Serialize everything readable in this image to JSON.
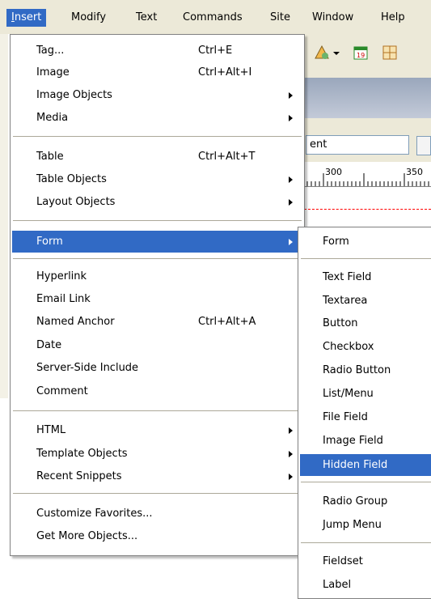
{
  "menubar": {
    "items": [
      {
        "label": "Insert",
        "accel": "I"
      },
      {
        "label": "Modify",
        "accel": "M"
      },
      {
        "label": "Text",
        "accel": "T"
      },
      {
        "label": "Commands",
        "accel": "C"
      },
      {
        "label": "Site",
        "accel": "S"
      },
      {
        "label": "Window",
        "accel": "W"
      },
      {
        "label": "Help",
        "accel": "H"
      }
    ]
  },
  "background": {
    "title_input_value": "ent",
    "ruler": {
      "label_300": "300",
      "label_350": "350"
    }
  },
  "insert_menu": {
    "items": [
      {
        "label": "Tag...",
        "shortcut": "Ctrl+E"
      },
      {
        "label": "Image",
        "shortcut": "Ctrl+Alt+I"
      },
      {
        "label": "Image Objects"
      },
      {
        "label": "Media"
      },
      {
        "label": "Table",
        "shortcut": "Ctrl+Alt+T"
      },
      {
        "label": "Table Objects"
      },
      {
        "label": "Layout Objects"
      },
      {
        "label": "Form"
      },
      {
        "label": "Hyperlink"
      },
      {
        "label": "Email Link"
      },
      {
        "label": "Named Anchor",
        "shortcut": "Ctrl+Alt+A"
      },
      {
        "label": "Date"
      },
      {
        "label": "Server-Side Include"
      },
      {
        "label": "Comment"
      },
      {
        "label": "HTML"
      },
      {
        "label": "Template Objects"
      },
      {
        "label": "Recent Snippets"
      },
      {
        "label": "Customize Favorites..."
      },
      {
        "label": "Get More Objects..."
      }
    ]
  },
  "form_submenu": {
    "items": [
      {
        "label": "Form"
      },
      {
        "label": "Text Field"
      },
      {
        "label": "Textarea"
      },
      {
        "label": "Button"
      },
      {
        "label": "Checkbox"
      },
      {
        "label": "Radio Button"
      },
      {
        "label": "List/Menu"
      },
      {
        "label": "File Field"
      },
      {
        "label": "Image Field"
      },
      {
        "label": "Hidden Field"
      },
      {
        "label": "Radio Group"
      },
      {
        "label": "Jump Menu"
      },
      {
        "label": "Fieldset"
      },
      {
        "label": "Label"
      }
    ]
  },
  "colors": {
    "highlight": "#316ac5",
    "menubar_bg": "#ece9d8"
  }
}
